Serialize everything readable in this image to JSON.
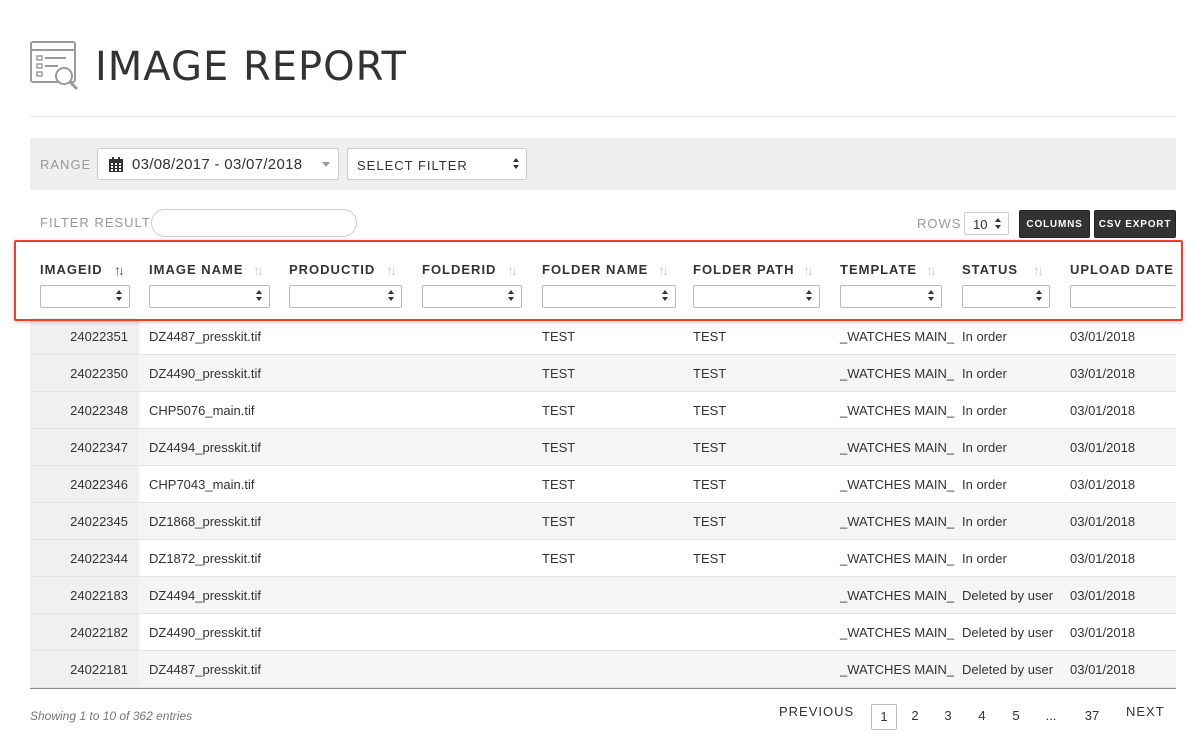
{
  "page": {
    "title": "IMAGE REPORT",
    "icon": "report-search-icon"
  },
  "toolbar": {
    "range_label": "RANGE",
    "range_value": "03/08/2017 - 03/07/2018",
    "calendar_icon": "calendar-icon",
    "filter_select_value": "SELECT FILTER",
    "filter_result_label": "FILTER RESULT",
    "filter_result_value": "",
    "rows_label": "ROWS",
    "rows_value": "10",
    "columns_button": "COLUMNS",
    "csv_export_button": "CSV EXPORT"
  },
  "table": {
    "columns": [
      {
        "label": "IMAGEID"
      },
      {
        "label": "IMAGE NAME"
      },
      {
        "label": "PRODUCTID"
      },
      {
        "label": "FOLDERID"
      },
      {
        "label": "FOLDER NAME"
      },
      {
        "label": "FOLDER PATH"
      },
      {
        "label": "TEMPLATE"
      },
      {
        "label": "STATUS"
      },
      {
        "label": "UPLOAD DATE"
      }
    ],
    "rows": [
      {
        "imageid": "24022351",
        "image_name": "DZ4487_presskit.tif",
        "productid": "",
        "folderid": "",
        "folder_name": "TEST",
        "folder_path": "TEST",
        "template": "_WATCHES MAIN_",
        "status": "In order",
        "upload_date": "03/01/2018"
      },
      {
        "imageid": "24022350",
        "image_name": "DZ4490_presskit.tif",
        "productid": "",
        "folderid": "",
        "folder_name": "TEST",
        "folder_path": "TEST",
        "template": "_WATCHES MAIN_",
        "status": "In order",
        "upload_date": "03/01/2018"
      },
      {
        "imageid": "24022348",
        "image_name": "CHP5076_main.tif",
        "productid": "",
        "folderid": "",
        "folder_name": "TEST",
        "folder_path": "TEST",
        "template": "_WATCHES MAIN_",
        "status": "In order",
        "upload_date": "03/01/2018"
      },
      {
        "imageid": "24022347",
        "image_name": "DZ4494_presskit.tif",
        "productid": "",
        "folderid": "",
        "folder_name": "TEST",
        "folder_path": "TEST",
        "template": "_WATCHES MAIN_",
        "status": "In order",
        "upload_date": "03/01/2018"
      },
      {
        "imageid": "24022346",
        "image_name": "CHP7043_main.tif",
        "productid": "",
        "folderid": "",
        "folder_name": "TEST",
        "folder_path": "TEST",
        "template": "_WATCHES MAIN_",
        "status": "In order",
        "upload_date": "03/01/2018"
      },
      {
        "imageid": "24022345",
        "image_name": "DZ1868_presskit.tif",
        "productid": "",
        "folderid": "",
        "folder_name": "TEST",
        "folder_path": "TEST",
        "template": "_WATCHES MAIN_",
        "status": "In order",
        "upload_date": "03/01/2018"
      },
      {
        "imageid": "24022344",
        "image_name": "DZ1872_presskit.tif",
        "productid": "",
        "folderid": "",
        "folder_name": "TEST",
        "folder_path": "TEST",
        "template": "_WATCHES MAIN_",
        "status": "In order",
        "upload_date": "03/01/2018"
      },
      {
        "imageid": "24022183",
        "image_name": "DZ4494_presskit.tif",
        "productid": "",
        "folderid": "",
        "folder_name": "",
        "folder_path": "",
        "template": "_WATCHES MAIN_",
        "status": "Deleted by user",
        "upload_date": "03/01/2018"
      },
      {
        "imageid": "24022182",
        "image_name": "DZ4490_presskit.tif",
        "productid": "",
        "folderid": "",
        "folder_name": "",
        "folder_path": "",
        "template": "_WATCHES MAIN_",
        "status": "Deleted by user",
        "upload_date": "03/01/2018"
      },
      {
        "imageid": "24022181",
        "image_name": "DZ4487_presskit.tif",
        "productid": "",
        "folderid": "",
        "folder_name": "",
        "folder_path": "",
        "template": "_WATCHES MAIN_",
        "status": "Deleted by user",
        "upload_date": "03/01/2018"
      }
    ]
  },
  "footer": {
    "entries_text": "Showing 1 to 10 of 362 entries",
    "previous_label": "PREVIOUS",
    "next_label": "NEXT",
    "pages": [
      "1",
      "2",
      "3",
      "4",
      "5",
      "...",
      "37"
    ],
    "current_page": "1"
  },
  "colors": {
    "highlight": "#e8402a",
    "button_dark": "#333333",
    "toolbar_bg": "#efefef"
  }
}
